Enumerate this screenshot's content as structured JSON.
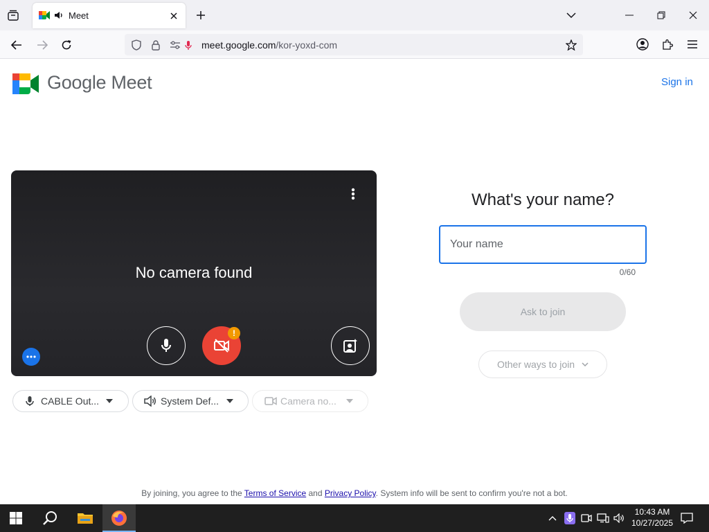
{
  "browser": {
    "tab": {
      "title": "Meet"
    },
    "url": {
      "domain": "meet.google.com",
      "path": "/kor-yoxd-com"
    }
  },
  "page": {
    "logo_text": "Google Meet",
    "sign_in": "Sign in",
    "preview": {
      "message": "No camera found"
    },
    "devices": {
      "microphone": "CABLE Out...",
      "speaker": "System Def...",
      "camera": "Camera no..."
    },
    "join": {
      "heading": "What's your name?",
      "name_placeholder": "Your name",
      "name_value": "",
      "counter": "0/60",
      "ask_button": "Ask to join",
      "other_ways": "Other ways to join"
    },
    "legal": {
      "prefix": "By joining, you agree to the ",
      "terms": "Terms of Service",
      "and": " and ",
      "privacy": "Privacy Policy",
      "suffix": ". System info will be sent to confirm you're not a bot."
    }
  },
  "taskbar": {
    "time": "10:43 AM",
    "date": "10/27/2025"
  },
  "colors": {
    "accent": "#1a73e8",
    "danger": "#ea4335",
    "warning": "#f29900"
  }
}
